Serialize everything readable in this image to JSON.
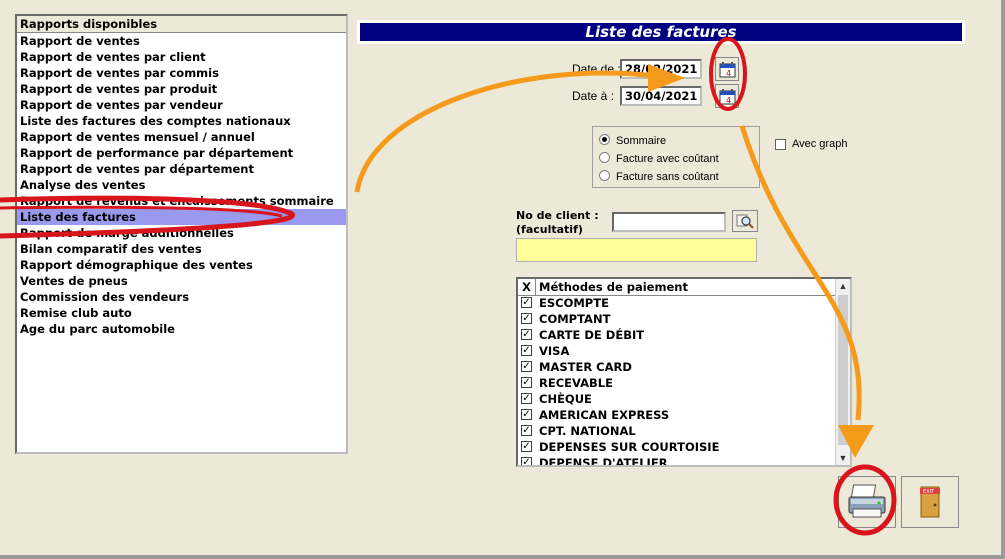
{
  "reports": {
    "header": "Rapports disponibles",
    "items": [
      "Rapport de ventes",
      "Rapport de ventes par client",
      "Rapport de ventes par commis",
      "Rapport de ventes par produit",
      "Rapport de ventes par vendeur",
      "Liste des factures des comptes nationaux",
      "Rapport de ventes mensuel / annuel",
      "Rapport de performance par département",
      "Rapport de ventes par département",
      "Analyse des ventes",
      "Rapport de revenus et encaissements sommaire",
      "Liste des factures",
      "Rapport de marge additionnelles",
      "Bilan comparatif des ventes",
      "Rapport démographique des ventes",
      "Ventes de pneus",
      "Commission des vendeurs",
      "Remise club auto",
      "Age du parc automobile"
    ],
    "selected_index": 11
  },
  "panel": {
    "title": "Liste des factures",
    "date_from_label": "Date de :",
    "date_from_value": "28/02/2021",
    "date_to_label": "Date à :",
    "date_to_value": "30/04/2021",
    "radio_options": [
      "Sommaire",
      "Facture avec coûtant",
      "Facture sans coûtant"
    ],
    "radio_selected": 0,
    "graph_label": "Avec graph",
    "client_label_1": "No de client :",
    "client_label_2": "(facultatif)",
    "client_value": ""
  },
  "payments": {
    "col_check": "X",
    "col_method": "Méthodes de paiement",
    "rows": [
      "ESCOMPTE",
      "COMPTANT",
      "CARTE DE DÉBIT",
      "VISA",
      "MASTER CARD",
      "RECEVABLE",
      "CHÈQUE",
      "AMERICAN EXPRESS",
      "CPT. NATIONAL",
      "DEPENSES SUR COURTOISIE",
      "DEPENSE D'ATELIER"
    ],
    "check_mark": "✓"
  },
  "icons": {
    "calendar": "calendar-icon",
    "search": "search-icon",
    "print": "printer-icon",
    "exit": "exit-door-icon"
  },
  "exit_label": "EXIT",
  "colors": {
    "title_bg": "#000080",
    "selection": "#9999ee",
    "annotation_orange": "#f59a1b",
    "annotation_red": "#d8141c",
    "client_name_bg": "#ffff99"
  }
}
